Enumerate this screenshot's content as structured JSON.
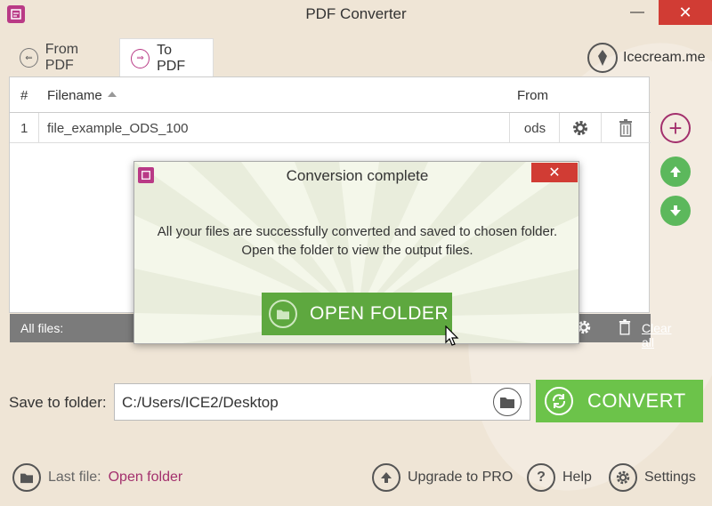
{
  "window": {
    "title": "PDF Converter",
    "minimize_label": "—",
    "close_label": "✕"
  },
  "tabs": [
    {
      "label": "From PDF",
      "icon": "from-pdf-icon",
      "active": false
    },
    {
      "label": "To PDF",
      "icon": "to-pdf-icon",
      "active": true
    }
  ],
  "brand": {
    "label": "Icecream.me",
    "icon": "icecream-icon"
  },
  "table": {
    "headers": {
      "num": "#",
      "filename": "Filename",
      "from": "From"
    },
    "rows": [
      {
        "num": "1",
        "filename": "file_example_ODS_100",
        "ext": "ods"
      }
    ],
    "footer": {
      "label": "All files:",
      "clear_all": "Clear all"
    }
  },
  "side_buttons": {
    "add": "+"
  },
  "save": {
    "label": "Save to folder:",
    "path": "C:/Users/ICE2/Desktop"
  },
  "convert": {
    "label": "CONVERT"
  },
  "bottom": {
    "last_file_label": "Last file:",
    "open_folder_link": "Open folder",
    "upgrade": "Upgrade to PRO",
    "help": "Help",
    "settings": "Settings"
  },
  "modal": {
    "title": "Conversion complete",
    "close_label": "✕",
    "line1": "All your files are successfully converted and saved to chosen folder.",
    "line2": "Open the folder to view the output files.",
    "open_folder": "OPEN FOLDER"
  },
  "colors": {
    "accent": "#b93a86",
    "green": "#6cc34a",
    "close_red": "#d13c34",
    "background": "#efe5d6"
  }
}
